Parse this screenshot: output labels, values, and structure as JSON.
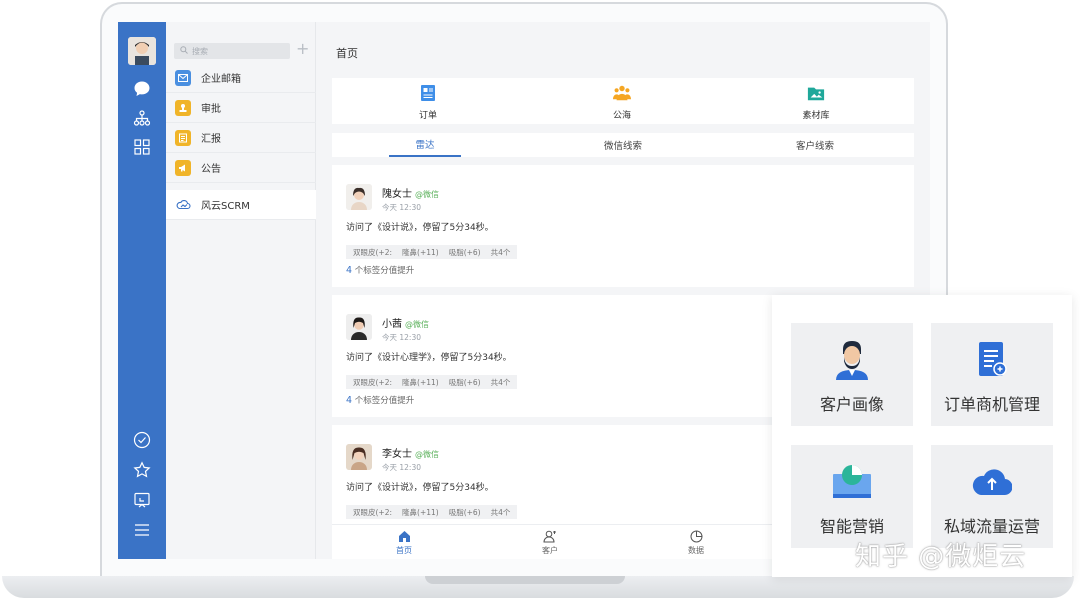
{
  "sidebar": {
    "search_placeholder": "搜索",
    "add_symbol": "+",
    "items": [
      {
        "label": "企业邮箱",
        "icon": "mail-icon",
        "color": "#4a8fe0"
      },
      {
        "label": "审批",
        "icon": "stamp-icon",
        "color": "#f0b429"
      },
      {
        "label": "汇报",
        "icon": "report-icon",
        "color": "#f0b429"
      },
      {
        "label": "公告",
        "icon": "megaphone-icon",
        "color": "#f0b429"
      },
      {
        "label": "风云SCRM",
        "icon": "cloud-icon",
        "color": "#3a73c6"
      }
    ]
  },
  "main": {
    "title": "首页",
    "top_actions": [
      {
        "label": "订单",
        "icon": "order-icon"
      },
      {
        "label": "公海",
        "icon": "people-icon"
      },
      {
        "label": "素材库",
        "icon": "folder-icon"
      }
    ],
    "tabs": [
      {
        "label": "雷达",
        "active": true
      },
      {
        "label": "微信线索",
        "active": false
      },
      {
        "label": "客户线索",
        "active": false
      }
    ],
    "cards": [
      {
        "name": "隗女士",
        "source": "@微信",
        "time": "今天 12:30",
        "text": "访问了《设计说》，停留了5分34秒。",
        "tags": [
          "双眼皮(+2:",
          "隆鼻(+11)",
          "吸脂(+6)",
          "共4个"
        ],
        "score_num": "4",
        "score_text": "个标签分值提升"
      },
      {
        "name": "小茜",
        "source": "@微信",
        "time": "今天 12:30",
        "text": "访问了《设计心理学》，停留了5分34秒。",
        "tags": [
          "双眼皮(+2:",
          "隆鼻(+11)",
          "吸脂(+6)",
          "共4个"
        ],
        "score_num": "4",
        "score_text": "个标签分值提升"
      },
      {
        "name": "李女士",
        "source": "@微信",
        "time": "今天 12:30",
        "text": "访问了《设计说》，停留了5分34秒。",
        "tags": [
          "双眼皮(+2:",
          "隆鼻(+11)",
          "吸脂(+6)",
          "共4个"
        ]
      }
    ],
    "bottom_nav": [
      {
        "label": "首页",
        "icon": "home-icon",
        "active": true
      },
      {
        "label": "客户",
        "icon": "customer-icon",
        "active": false
      },
      {
        "label": "数据",
        "icon": "pie-icon",
        "active": false
      }
    ]
  },
  "features": [
    {
      "label": "客户画像",
      "icon": "person-icon"
    },
    {
      "label": "订单商机管理",
      "icon": "document-icon"
    },
    {
      "label": "智能营销",
      "icon": "chart-screen-icon"
    },
    {
      "label": "私域流量运营",
      "icon": "cloud-upload-icon"
    }
  ],
  "watermark": "知乎 @微炬云",
  "colors": {
    "accent": "#3a73c6",
    "wechat": "#5bb15b",
    "tile": "#eff0f2"
  }
}
